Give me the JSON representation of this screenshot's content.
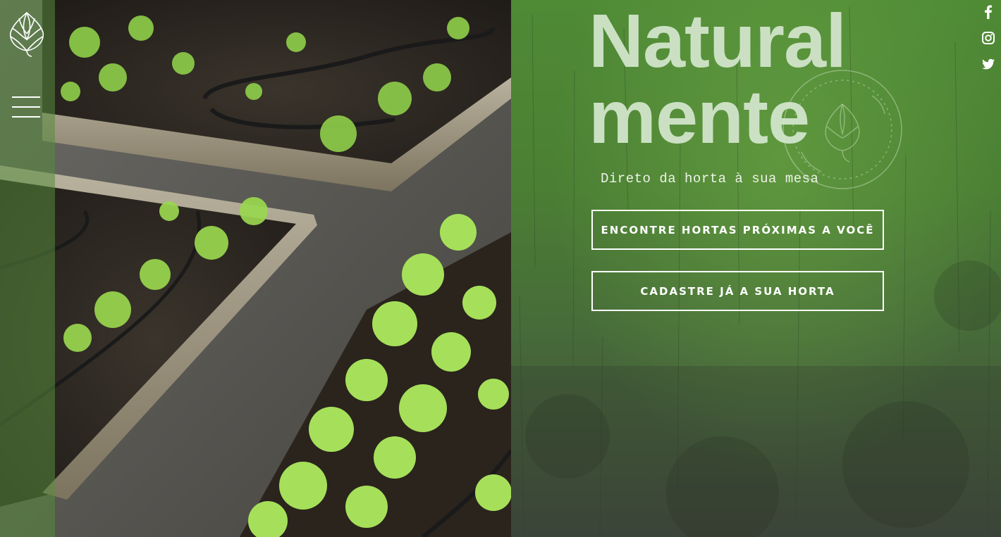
{
  "hero": {
    "title_line1": "Natural",
    "title_line2": "mente",
    "subtitle": "Direto da horta à sua mesa"
  },
  "buttons": {
    "find_gardens": "ENCONTRE HORTAS PRÓXIMAS A VOCÊ",
    "register_garden": "CADASTRE JÁ A SUA HORTA"
  },
  "icons": {
    "logo": "artichoke-logo",
    "menu": "hamburger-menu-icon",
    "emblem": "artichoke-emblem",
    "social": [
      "facebook-icon",
      "instagram-icon",
      "twitter-icon"
    ]
  },
  "colors": {
    "green_panel": "#4f8a35",
    "title": "#d4e6cd",
    "sidebar": "#588c3c"
  }
}
